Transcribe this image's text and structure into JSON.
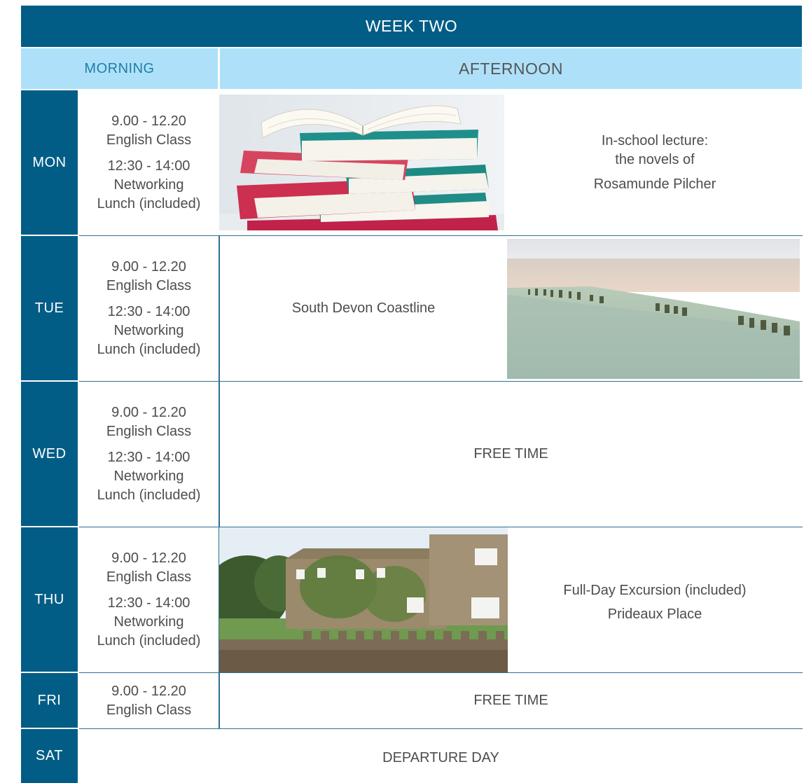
{
  "title": "WEEK TWO",
  "headers": {
    "morning": "MORNING",
    "afternoon": "AFTERNOON"
  },
  "days": [
    {
      "day": "MON",
      "morning": [
        "9.00 - 12.20",
        "English Class",
        "12:30 - 14:00",
        "Networking",
        "Lunch (included)"
      ],
      "afternoon": [
        "In-school lecture:",
        "the novels of",
        "Rosamunde Pilcher"
      ],
      "image": "stack-of-books-image"
    },
    {
      "day": "TUE",
      "morning": [
        "9.00 - 12.20",
        "English Class",
        "12:30 - 14:00",
        "Networking",
        "Lunch (included)"
      ],
      "afternoon": [
        "South Devon Coastline"
      ],
      "image": "beach-coastline-image"
    },
    {
      "day": "WED",
      "morning": [
        "9.00 - 12.20",
        "English Class",
        "12:30 - 14:00",
        "Networking",
        "Lunch (included)"
      ],
      "afternoon": [
        "FREE TIME"
      ]
    },
    {
      "day": "THU",
      "morning": [
        "9.00 - 12.20",
        "English Class",
        "12:30 - 14:00",
        "Networking",
        "Lunch (included)"
      ],
      "afternoon": [
        "Full-Day Excursion (included)",
        "Prideaux Place"
      ],
      "image": "prideaux-place-manor-image"
    },
    {
      "day": "FRI",
      "morning": [
        "9.00 - 12.20",
        "English Class"
      ],
      "afternoon": [
        "FREE TIME"
      ]
    },
    {
      "day": "SAT",
      "afternoon": [
        "DEPARTURE DAY"
      ]
    }
  ],
  "colors": {
    "navy": "#025d86",
    "light_blue": "#aee1f9",
    "line": "#2e6f92"
  }
}
